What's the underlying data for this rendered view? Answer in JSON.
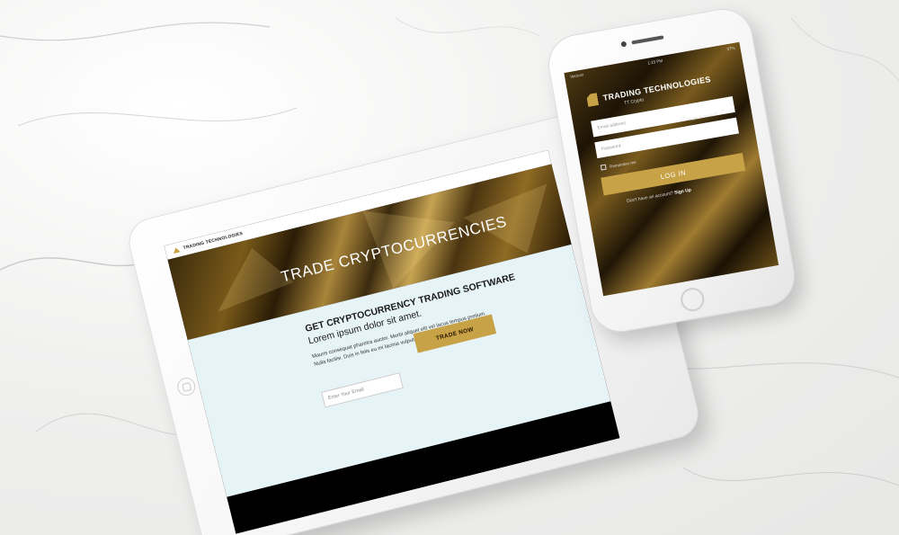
{
  "colors": {
    "gold_accent": "#c8a247",
    "tablet_body_bg": "#e7f4f7",
    "dark_bg": "#000000"
  },
  "tablet": {
    "header_brand": "TRADING TECHNOLOGIES",
    "hero_title": "TRADE CRYPTOCURRENCIES",
    "subheading": "GET CRYPTOCURRENCY TRADING SOFTWARE",
    "subheading_line2": "Lorem ipsum dolor sit amet.",
    "paragraph": "Mauris consequat pharetra auctor. Morbi aliquet elit vel lacus tempus pretium. Nulla facilisi. Duis in felis eu mi lacinia vulputate.",
    "cta_label": "TRADE NOW",
    "email_placeholder": "Enter Your Email"
  },
  "phone": {
    "status_carrier": "Verizon",
    "status_time": "1:23 PM",
    "status_battery": "37%",
    "brand": "TRADING TECHNOLOGIES",
    "brand_sub": "TT Crypto",
    "email_placeholder": "Email address",
    "password_placeholder": "Password",
    "forgot_label": "forgot password?",
    "remember_label": "Remember me",
    "login_label": "LOG IN",
    "signup_prompt": "Don't have an account?",
    "signup_link": "Sign Up"
  }
}
